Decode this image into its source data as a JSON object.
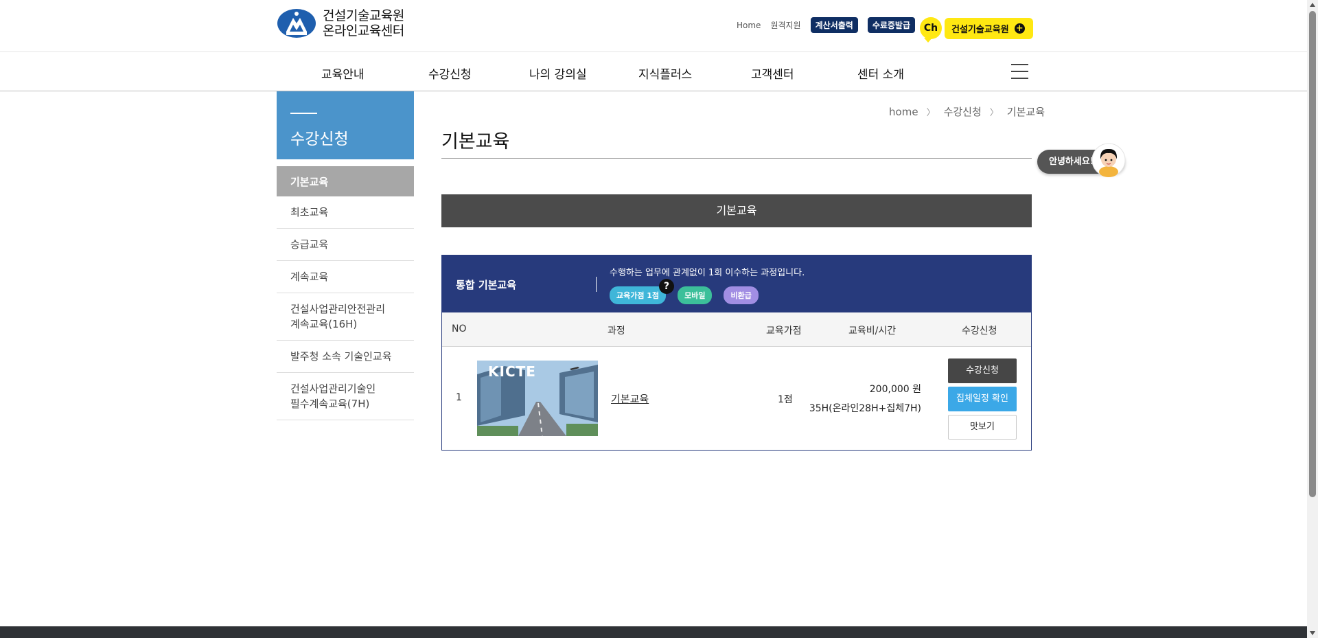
{
  "header": {
    "logo_line1": "건설기술교육원",
    "logo_line2": "온라인교육센터",
    "util_home": "Home",
    "util_remote": "원격지원",
    "badge_invoice": "계산서출력",
    "badge_certificate": "수료증발급",
    "kakao_ch": "Ch",
    "kakao_label": "건설기술교육원",
    "kakao_plus": "+"
  },
  "nav": [
    "교육안내",
    "수강신청",
    "나의 강의실",
    "지식플러스",
    "고객센터",
    "센터 소개"
  ],
  "sidebar": {
    "title": "수강신청",
    "items": [
      {
        "label": "기본교육",
        "active": true
      },
      {
        "label": "최초교육"
      },
      {
        "label": "승급교육"
      },
      {
        "label": "계속교육"
      },
      {
        "label": "건설사업관리안전관리\n계속교육(16H)"
      },
      {
        "label": "발주청 소속 기술인교육"
      },
      {
        "label": "건설사업관리기술인\n필수계속교육(7H)"
      }
    ]
  },
  "breadcrumb": [
    "home",
    "수강신청",
    "기본교육"
  ],
  "page_title": "기본교육",
  "section_title": "기본교육",
  "course": {
    "name": "통합 기본교육",
    "description": "수행하는 업무에 관계없이 1회 이수하는 과정입니다.",
    "tags": [
      "교육가점 1점",
      "모바일",
      "비환급"
    ],
    "tag_help": "?",
    "columns": [
      "NO",
      "과정",
      "교육가점",
      "교육비/시간",
      "수강신청"
    ],
    "rows": [
      {
        "no": "1",
        "thumb_text": "KICTE",
        "title": "기본교육",
        "points": "1점",
        "fee": "200,000 원",
        "hours": "35H(온라인28H+집체7H)",
        "btn_apply": "수강신청",
        "btn_schedule": "집체일정 확인",
        "btn_preview": "맛보기"
      }
    ]
  },
  "float_chat": "안녕하세요!",
  "colors": {
    "navy": "#273a7c",
    "side_blue": "#4b94cb",
    "kakao_yellow": "#ffe812",
    "sky_button": "#3ba8e7"
  }
}
